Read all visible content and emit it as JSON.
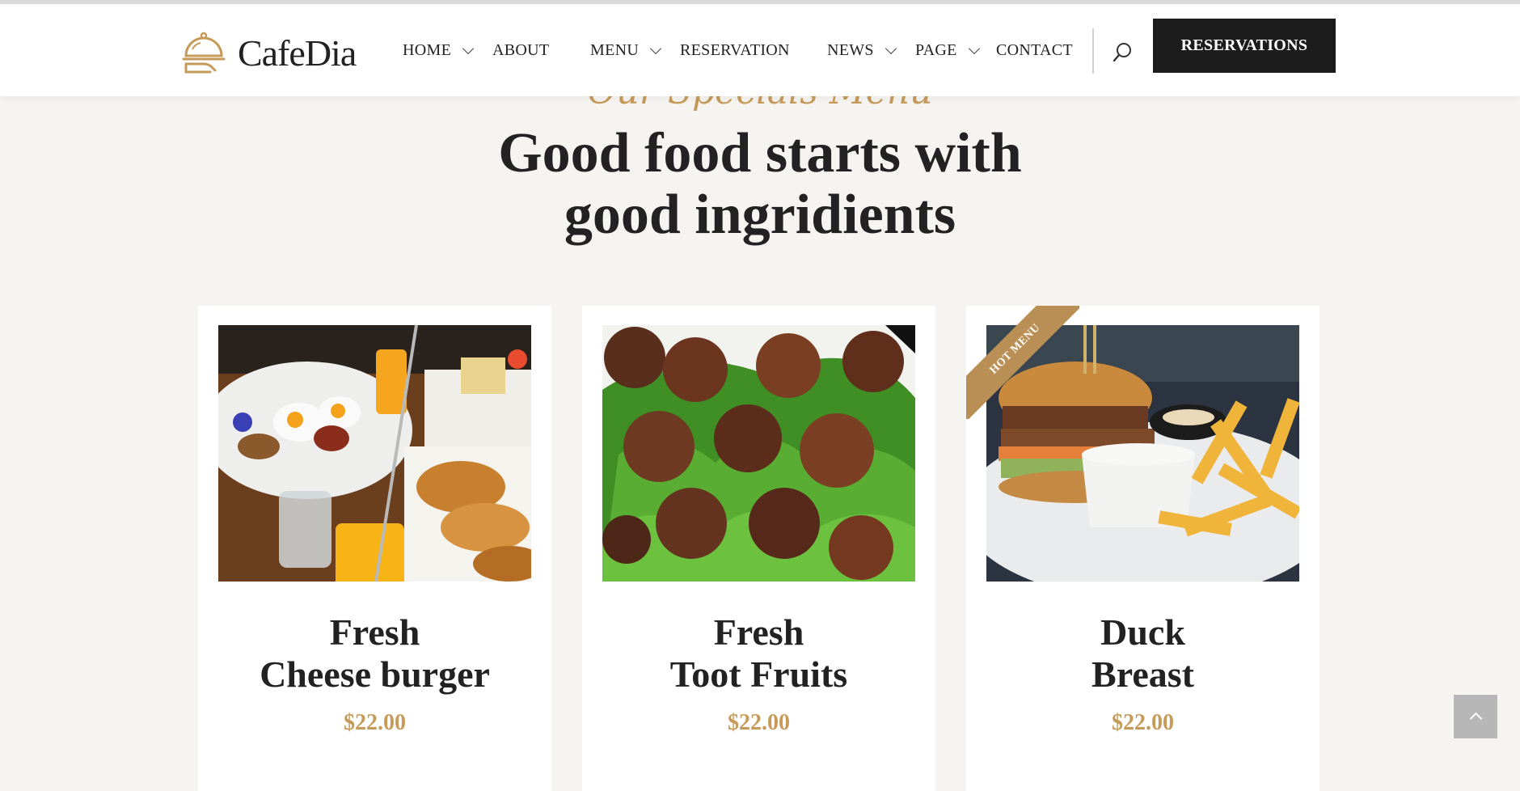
{
  "brand": {
    "name": "CafeDia"
  },
  "nav": {
    "items": [
      {
        "label": "HOME",
        "has_dropdown": true
      },
      {
        "label": "ABOUT",
        "has_dropdown": false
      },
      {
        "label": "MENU",
        "has_dropdown": true
      },
      {
        "label": "RESERVATION",
        "has_dropdown": false
      },
      {
        "label": "NEWS",
        "has_dropdown": true
      },
      {
        "label": "PAGE",
        "has_dropdown": true
      },
      {
        "label": "CONTACT",
        "has_dropdown": false
      }
    ],
    "search_icon": "search-icon",
    "cta_label": "RESERVATIONS"
  },
  "section": {
    "subtitle": "Our Specials Menu",
    "headline_line1": "Good food starts with",
    "headline_line2": "good ingridients"
  },
  "cards": [
    {
      "title_line1": "Fresh",
      "title_line2": "Cheese burger",
      "price": "$22.00",
      "badge": ""
    },
    {
      "title_line1": "Fresh",
      "title_line2": "Toot Fruits",
      "price": "$22.00",
      "badge": ""
    },
    {
      "title_line1": "Duck",
      "title_line2": "Breast",
      "price": "$22.00",
      "badge": "HOT MENU"
    }
  ],
  "colors": {
    "accent": "#c69b5a",
    "ribbon": "#b98f55",
    "dark": "#1c1c1c",
    "background": "#f6f4f0"
  }
}
